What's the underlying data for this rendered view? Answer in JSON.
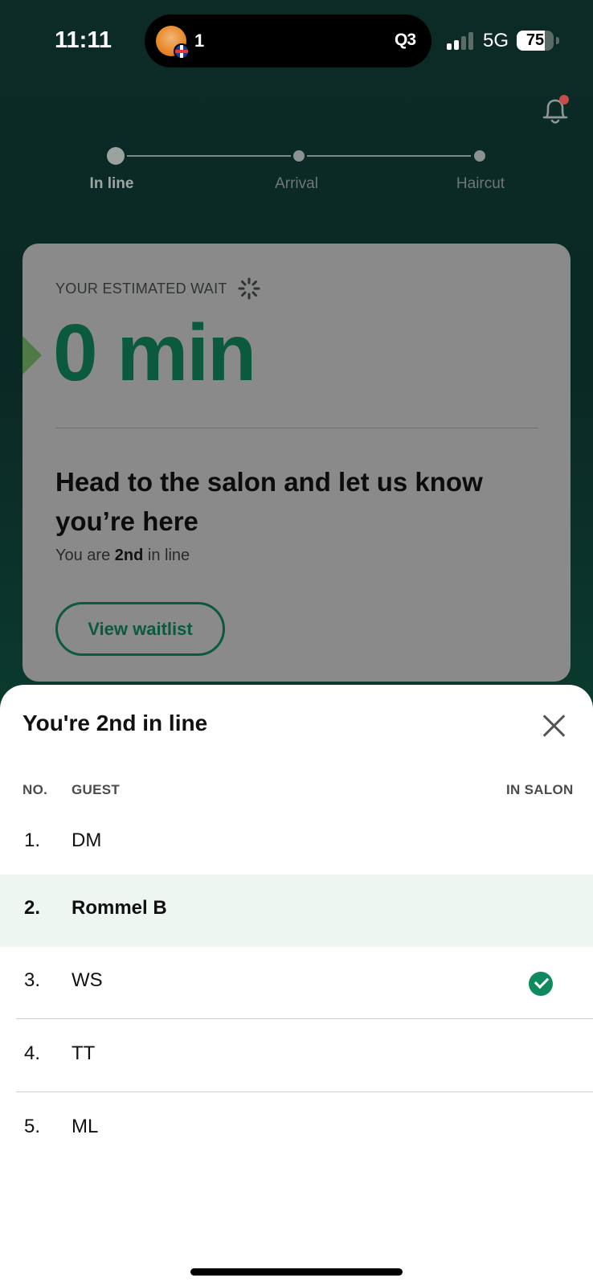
{
  "status_bar": {
    "time": "11:11",
    "island_count": "1",
    "island_label": "Q3",
    "network": "5G",
    "battery_percent": "75",
    "battery_level": 0.75,
    "signal_bars_active": 2,
    "signal_bars_total": 4
  },
  "notifications": {
    "icon": "bell-icon",
    "has_unread": true
  },
  "progress": {
    "steps": [
      {
        "label": "In line",
        "active": true
      },
      {
        "label": "Arrival",
        "active": false
      },
      {
        "label": "Haircut",
        "active": false
      }
    ]
  },
  "wait_card": {
    "label": "YOUR ESTIMATED WAIT",
    "value": "0 min",
    "headline": "Head to the salon and let us know you’re here",
    "position_prefix": "You are ",
    "position_ordinal": "2nd",
    "position_suffix": " in line",
    "view_waitlist_label": "View waitlist"
  },
  "waitlist_sheet": {
    "title": "You're 2nd in line",
    "columns": {
      "no": "NO.",
      "guest": "GUEST",
      "in_salon": "IN SALON"
    },
    "rows": [
      {
        "no": "1.",
        "guest": "DM",
        "in_salon": false,
        "current": false
      },
      {
        "no": "2.",
        "guest": "Rommel B",
        "in_salon": false,
        "current": true
      },
      {
        "no": "3.",
        "guest": "WS",
        "in_salon": true,
        "current": false
      },
      {
        "no": "4.",
        "guest": "TT",
        "in_salon": false,
        "current": false
      },
      {
        "no": "5.",
        "guest": "ML",
        "in_salon": false,
        "current": false
      }
    ]
  },
  "colors": {
    "brand_green": "#0b5a3d",
    "check_green": "#0f8a5f",
    "current_row_bg": "#eef6f2",
    "notification_dot": "#c94b45"
  }
}
